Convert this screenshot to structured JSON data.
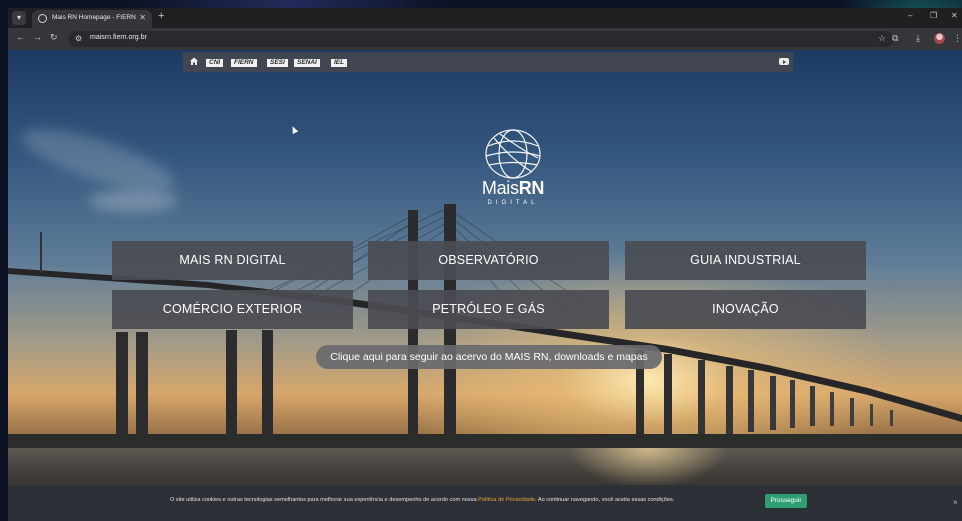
{
  "browser": {
    "tab_title": "Mais RN Homepage - FIERN",
    "url": "maisrn.fiern.org.br",
    "icons": [
      "tab-menu-icon",
      "favicon",
      "close-icon",
      "plus-icon",
      "minimize-icon",
      "maximize-icon",
      "close-window-icon",
      "back-icon",
      "forward-icon",
      "reload-icon",
      "site-settings-icon",
      "star-icon",
      "extensions-icon",
      "download-icon",
      "profile-avatar",
      "more-icon"
    ]
  },
  "topnav": {
    "links": [
      "CNI",
      "FIERN",
      "SESI",
      "SENAI",
      "IEL"
    ],
    "icons": [
      "home-icon",
      "youtube-icon"
    ]
  },
  "logo": {
    "main_light": "Mais",
    "main_bold": "RN",
    "sub": "DIGITAL"
  },
  "menu": {
    "items": [
      "MAIS RN DIGITAL",
      "OBSERVATÓRIO",
      "GUIA INDUSTRIAL",
      "COMÉRCIO EXTERIOR",
      "PETRÓLEO E GÁS",
      "INOVAÇÃO"
    ]
  },
  "archive_link": "Clique aqui para seguir ao acervo do MAIS RN, downloads e mapas",
  "cookie": {
    "text_before": "O site utiliza cookies e outras tecnologias semelhantes para melhorar sua experiência e desempenho de acordo com nossa ",
    "link": "Política de Privacidade",
    "text_after": ". Ao continuar navegando, você aceita essas condições.",
    "accept": "Prosseguir",
    "close": "×"
  },
  "colors": {
    "button_bg": "#4a4c52",
    "accept_green": "#2e9f72",
    "link_orange": "#e7a43b"
  }
}
